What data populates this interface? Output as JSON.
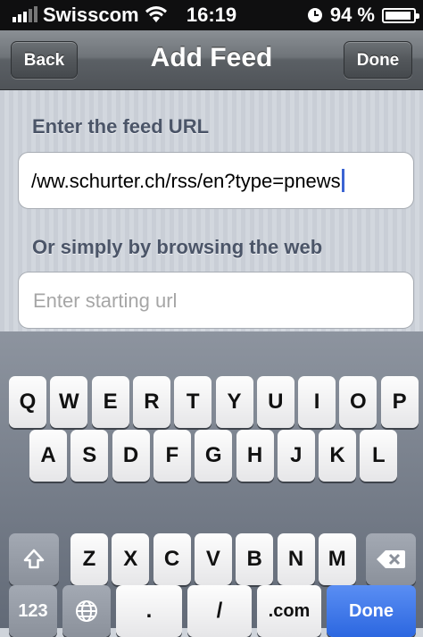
{
  "status_bar": {
    "carrier": "Swisscom",
    "time": "16:19",
    "battery": "94 %",
    "battery_level": 0.94
  },
  "nav": {
    "back_label": "Back",
    "title": "Add Feed",
    "done_label": "Done"
  },
  "form": {
    "feed_url_label": "Enter the feed URL",
    "feed_url_value": "/ww.schurter.ch/rss/en?type=pnews",
    "browse_label": "Or simply by browsing the web",
    "start_url_placeholder": "Enter starting url"
  },
  "keyboard": {
    "row1": [
      "Q",
      "W",
      "E",
      "R",
      "T",
      "Y",
      "U",
      "I",
      "O",
      "P"
    ],
    "row2": [
      "A",
      "S",
      "D",
      "F",
      "G",
      "H",
      "J",
      "K",
      "L"
    ],
    "row3": [
      "Z",
      "X",
      "C",
      "V",
      "B",
      "N",
      "M"
    ],
    "numbers_label": "123",
    "dot_label": ".",
    "slash_label": "/",
    "dotcom_label": ".com",
    "done_label": "Done",
    "icons": {
      "shift": "shift-icon",
      "backspace": "backspace-icon",
      "globe": "globe-icon"
    }
  }
}
